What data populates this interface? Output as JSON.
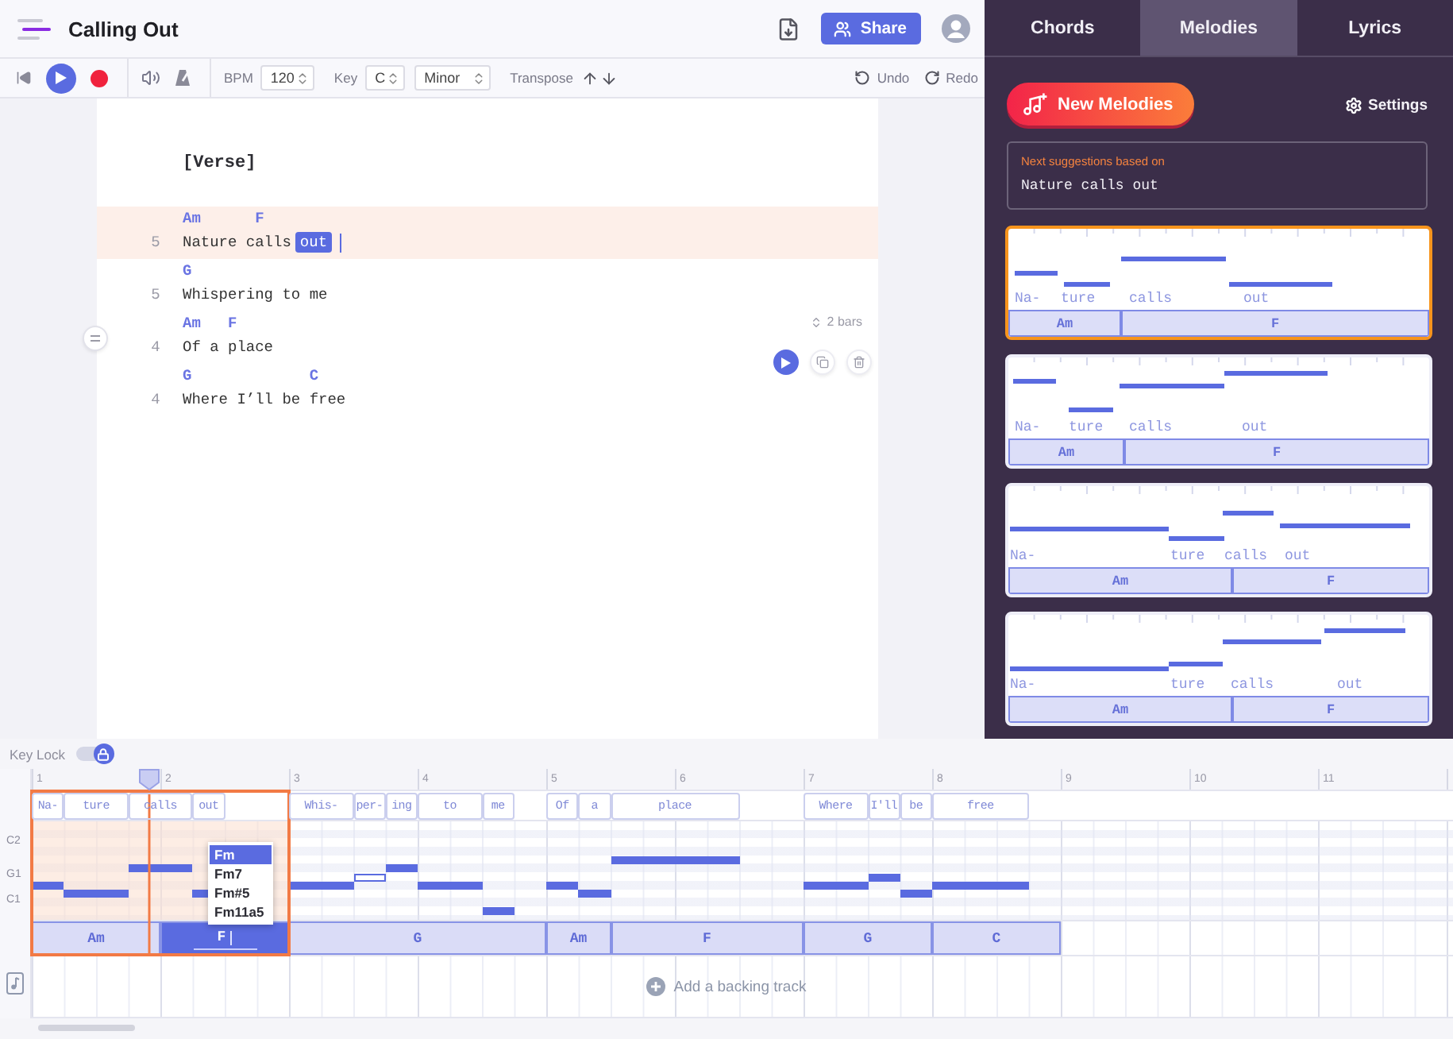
{
  "header": {
    "title": "Calling Out",
    "share": "Share"
  },
  "toolbar": {
    "bpm_label": "BPM",
    "bpm": "120",
    "key_label": "Key",
    "key": "C",
    "mode": "Minor",
    "transpose_label": "Transpose",
    "undo": "Undo",
    "redo": "Redo"
  },
  "editor": {
    "section": "[Verse]",
    "lines": [
      {
        "chords": "Am      F",
        "number": "5",
        "lyric": "Nature calls",
        "selected_text": "out",
        "selected": true,
        "hovered": false
      },
      {
        "chords": "G",
        "number": "5",
        "lyric": "Whispering to me",
        "selected": false,
        "hovered": false
      },
      {
        "chords": "Am   F",
        "number": "4",
        "lyric": "Of a place",
        "selected": false,
        "hovered": true,
        "bars": "2 bars"
      },
      {
        "chords": "G             C",
        "number": "4",
        "lyric": "Where I’ll be free",
        "selected": false,
        "hovered": false
      }
    ]
  },
  "panel": {
    "tabs": [
      {
        "label": "Chords",
        "selected": false
      },
      {
        "label": "Melodies",
        "selected": true
      },
      {
        "label": "Lyrics",
        "selected": false
      }
    ],
    "new_button": "New Melodies",
    "settings": "Settings",
    "suggestion": {
      "caption": "Next suggestions based on",
      "text": "Nature calls out"
    },
    "melodies": [
      {
        "selected": true,
        "syllables": [
          "Na-",
          "ture",
          "calls",
          "out"
        ],
        "chords": [
          "Am",
          "F"
        ]
      },
      {
        "selected": false,
        "syllables": [
          "Na-",
          "ture",
          "calls",
          "out"
        ],
        "chords": [
          "Am",
          "F"
        ]
      },
      {
        "selected": false,
        "syllables": [
          "Na-",
          "ture",
          "calls",
          "out"
        ],
        "chords": [
          "Am",
          "F"
        ]
      },
      {
        "selected": false,
        "syllables": [
          "Na-",
          "ture",
          "calls",
          "out"
        ],
        "chords": [
          "Am",
          "F"
        ]
      }
    ]
  },
  "roll": {
    "key_lock": {
      "label": "Key Lock",
      "on": true
    },
    "bars": [
      "1",
      "2",
      "3",
      "4",
      "5",
      "6",
      "7",
      "8",
      "9",
      "10",
      "11"
    ],
    "pitches": [
      "C2",
      "G1",
      "C1"
    ],
    "syllables": [
      "Na-",
      "ture",
      "calls",
      "out",
      "Whis-",
      "per-",
      "ing",
      "to",
      "me",
      "Of",
      "a",
      "place",
      "Where",
      "I'll",
      "be",
      "free"
    ],
    "chords": [
      {
        "name": "Am",
        "selected": false,
        "in_selection": true
      },
      {
        "name": "F",
        "selected": true,
        "in_selection": true
      },
      {
        "name": "G",
        "selected": false,
        "in_selection": false
      },
      {
        "name": "Am",
        "selected": false,
        "in_selection": false
      },
      {
        "name": "F",
        "selected": false,
        "in_selection": false
      },
      {
        "name": "G",
        "selected": false,
        "in_selection": false
      },
      {
        "name": "C",
        "selected": false,
        "in_selection": false
      }
    ],
    "chord_menu": [
      {
        "label": "Fm",
        "selected": true
      },
      {
        "label": "Fm7",
        "selected": false
      },
      {
        "label": "Fm#5",
        "selected": false
      },
      {
        "label": "Fm11a5",
        "selected": false
      }
    ],
    "backing": "Add a backing track"
  }
}
